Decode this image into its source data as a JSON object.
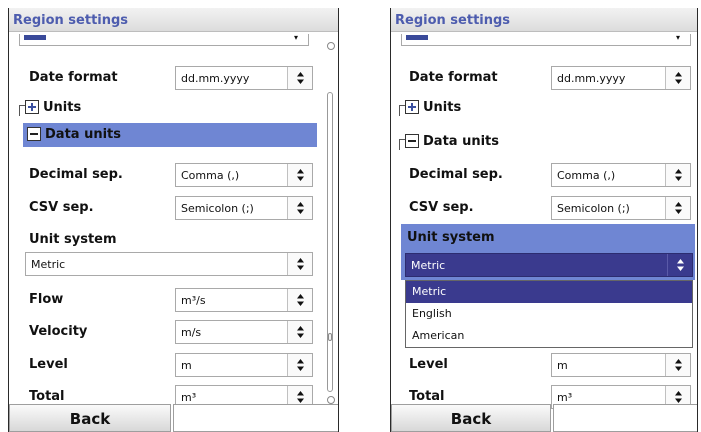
{
  "left": {
    "title": "Region settings",
    "date_format": {
      "label": "Date format",
      "value": "dd.mm.yyyy"
    },
    "units": {
      "label": "Units"
    },
    "data_units": {
      "label": "Data units"
    },
    "decimal_sep": {
      "label": "Decimal sep.",
      "value": "Comma (,)"
    },
    "csv_sep": {
      "label": "CSV sep.",
      "value": "Semicolon (;)"
    },
    "unit_system": {
      "label": "Unit system",
      "value": "Metric"
    },
    "flow": {
      "label": "Flow",
      "value": "m³/s"
    },
    "velocity": {
      "label": "Velocity",
      "value": "m/s"
    },
    "level": {
      "label": "Level",
      "value": "m"
    },
    "total": {
      "label": "Total",
      "value": "m³"
    },
    "back_label": "Back"
  },
  "right": {
    "title": "Region settings",
    "date_format": {
      "label": "Date format",
      "value": "dd.mm.yyyy"
    },
    "units": {
      "label": "Units"
    },
    "data_units": {
      "label": "Data units"
    },
    "decimal_sep": {
      "label": "Decimal sep.",
      "value": "Comma (,)"
    },
    "csv_sep": {
      "label": "CSV sep.",
      "value": "Semicolon (;)"
    },
    "unit_system": {
      "label": "Unit system",
      "value": "Metric"
    },
    "unit_system_options": [
      "Metric",
      "English",
      "American"
    ],
    "level": {
      "label": "Level",
      "value": "m"
    },
    "total": {
      "label": "Total",
      "value": "m³"
    },
    "back_label": "Back"
  },
  "colors": {
    "title_text": "#4d5cae",
    "highlight_bar": "#6f86d3",
    "dropdown_active": "#3a3a8e",
    "selected_option": "#3a3a8e"
  },
  "icons": [
    "chevron-up-down-icon",
    "plus-icon",
    "minus-icon"
  ]
}
